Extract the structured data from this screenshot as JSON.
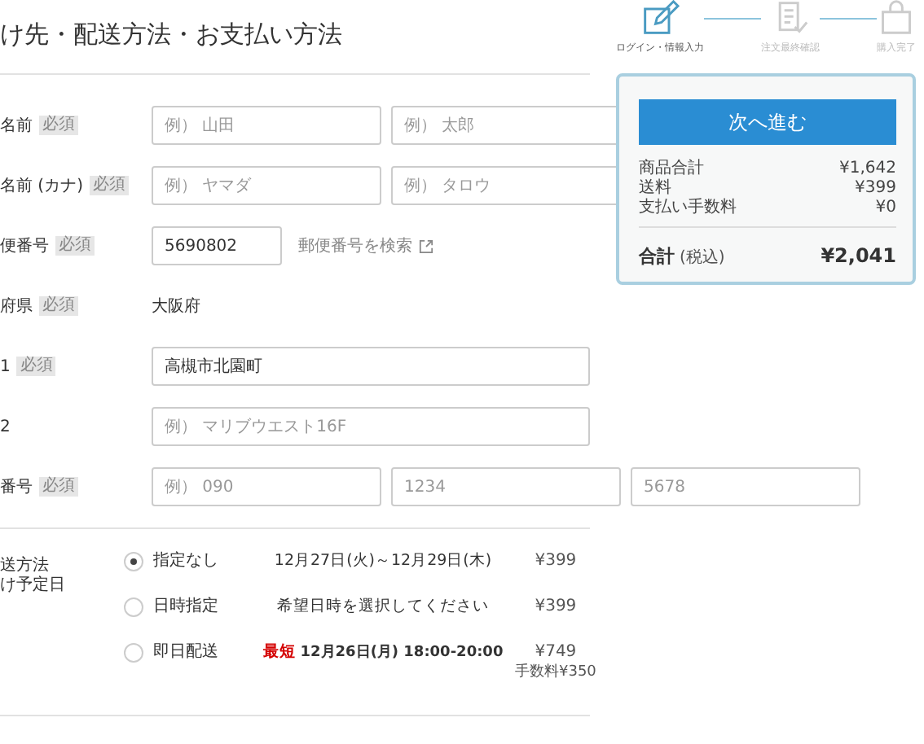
{
  "page_title": "け先・配送方法・お支払い方法",
  "steps": [
    {
      "label": "ログイン・情報入力",
      "selected": true
    },
    {
      "label": "注文最終確認",
      "selected": false
    },
    {
      "label": "購入完了",
      "selected": false
    }
  ],
  "form_rows": [
    {
      "kind": "inputs",
      "label": "名前",
      "badge": "必須",
      "fields": [
        {
          "placeholder": "例） 山田"
        },
        {
          "placeholder": "例） 太郎"
        }
      ]
    },
    {
      "kind": "inputs",
      "label": "名前 (カナ)",
      "badge": "必須",
      "fields": [
        {
          "placeholder": "例） ヤマダ"
        },
        {
          "placeholder": "例） タロウ"
        }
      ]
    },
    {
      "kind": "postal",
      "label": "便番号",
      "badge": "必須",
      "fields": [
        {
          "value": "5690802"
        }
      ],
      "link": "郵便番号を検索"
    },
    {
      "kind": "text",
      "label": "府県",
      "badge": "必須",
      "text": "大阪府"
    },
    {
      "kind": "inputs",
      "label": "1",
      "badge": "必須",
      "fields": [
        {
          "value": "高槻市北園町"
        }
      ]
    },
    {
      "kind": "inputs",
      "label": "2",
      "fields": [
        {
          "placeholder": "例） マリブウエスト16F"
        }
      ]
    },
    {
      "kind": "inputs",
      "label": "番号",
      "badge": "必須",
      "fields": [
        {
          "placeholder": "例） 090"
        },
        {
          "placeholder": "1234"
        },
        {
          "placeholder": "5678"
        }
      ]
    }
  ],
  "delivery": {
    "labels": [
      "送方法",
      "け予定日"
    ],
    "options": [
      {
        "label": "指定なし",
        "selected": true,
        "date": "12月27日(火)～12月29日(木)",
        "price": "¥399"
      },
      {
        "label": "日時指定",
        "selected": false,
        "date": "希望日時を選択してください",
        "price": "¥399"
      },
      {
        "label": "即日配送",
        "selected": false,
        "tag": "最短",
        "date": "12月26日(月) 18:00-20:00",
        "price": "¥749",
        "fee": "手数料¥350"
      }
    ]
  },
  "summary": {
    "button": "次へ進む",
    "lines": [
      {
        "label": "商品合計",
        "value": "¥1,642"
      },
      {
        "label": "送料",
        "value": "¥399"
      },
      {
        "label": "支払い手数料",
        "value": "¥0"
      }
    ],
    "total_label": "合計",
    "total_note": "(税込)",
    "total_value": "¥2,041"
  }
}
